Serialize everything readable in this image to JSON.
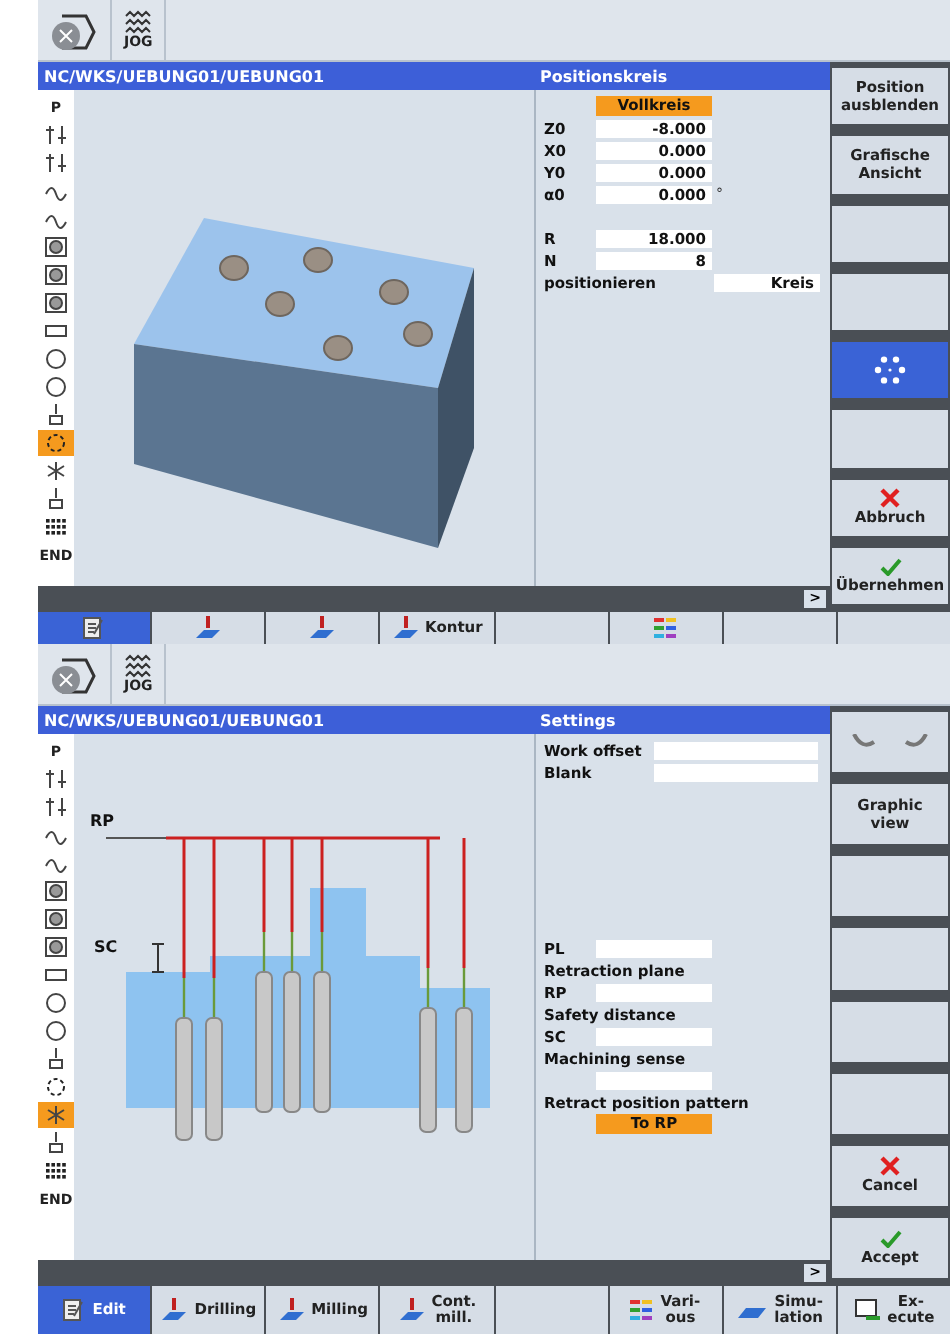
{
  "screens": [
    {
      "mode_label": "JOG",
      "path": "NC/WKS/UEBUNG01/UEBUNG01",
      "panel_title": "Positionskreis",
      "graphic": {
        "kind": "block"
      },
      "more_label": ">",
      "program_steps": [
        {
          "kind": "letter",
          "text": "P",
          "selected": false
        },
        {
          "kind": "arrows",
          "selected": false
        },
        {
          "kind": "arrows",
          "selected": false
        },
        {
          "kind": "wave",
          "selected": false
        },
        {
          "kind": "wave",
          "selected": false
        },
        {
          "kind": "disc",
          "selected": false
        },
        {
          "kind": "disc",
          "selected": false
        },
        {
          "kind": "disc",
          "selected": false
        },
        {
          "kind": "rect",
          "selected": false
        },
        {
          "kind": "circle",
          "selected": false
        },
        {
          "kind": "circle",
          "selected": false
        },
        {
          "kind": "drill",
          "selected": false
        },
        {
          "kind": "ring",
          "selected": true
        },
        {
          "kind": "star",
          "selected": false
        },
        {
          "kind": "drill",
          "selected": false
        },
        {
          "kind": "grid",
          "selected": false
        },
        {
          "kind": "letter",
          "text": "END",
          "selected": false
        }
      ],
      "params": [
        {
          "kind": "select",
          "value": "Vollkreis"
        },
        {
          "kind": "field",
          "label": "Z0",
          "value": "-8.000"
        },
        {
          "kind": "field",
          "label": "X0",
          "value": "0.000"
        },
        {
          "kind": "field",
          "label": "Y0",
          "value": "0.000"
        },
        {
          "kind": "field",
          "label": "α0",
          "value": "0.000",
          "unit": "°"
        },
        {
          "kind": "gap"
        },
        {
          "kind": "field",
          "label": "R",
          "value": "18.000"
        },
        {
          "kind": "field",
          "label": "N",
          "value": "8"
        },
        {
          "kind": "choice",
          "label": "positionieren",
          "value": "Kreis"
        }
      ],
      "softkeys_right": [
        {
          "lines": [
            "Position",
            "ausblenden"
          ],
          "kind": "plain",
          "selected": false
        },
        {
          "lines": [
            "Grafische",
            "Ansicht"
          ],
          "kind": "plain",
          "selected": false
        },
        {
          "kind": "plain",
          "selected": false
        },
        {
          "kind": "plain",
          "selected": false
        },
        {
          "kind": "ring",
          "selected": true
        },
        {
          "kind": "plain",
          "selected": false
        },
        {
          "lines": [
            "Abbruch"
          ],
          "kind": "cross",
          "selected": false
        },
        {
          "lines": [
            "Übernehmen"
          ],
          "kind": "check",
          "selected": false
        }
      ],
      "softkeys_bottom": [
        {
          "kind": "edit",
          "selected": true
        },
        {
          "kind": "drill",
          "selected": false
        },
        {
          "kind": "drill",
          "selected": false
        },
        {
          "lines": [
            "Kontur"
          ],
          "kind": "drill",
          "selected": false
        },
        {
          "kind": "plain",
          "selected": false
        },
        {
          "kind": "bars",
          "selected": false
        },
        {
          "kind": "plain",
          "selected": false
        },
        {
          "kind": "plain",
          "selected": false
        }
      ]
    },
    {
      "mode_label": "JOG",
      "path": "NC/WKS/UEBUNG01/UEBUNG01",
      "panel_title": "Settings",
      "graphic": {
        "kind": "drilling",
        "rp_label": "RP",
        "sc_label": "SC"
      },
      "more_label": ">",
      "program_steps": [
        {
          "kind": "letter",
          "text": "P",
          "selected": false
        },
        {
          "kind": "arrows",
          "selected": false
        },
        {
          "kind": "arrows",
          "selected": false
        },
        {
          "kind": "wave",
          "selected": false
        },
        {
          "kind": "wave",
          "selected": false
        },
        {
          "kind": "disc",
          "selected": false
        },
        {
          "kind": "disc",
          "selected": false
        },
        {
          "kind": "disc",
          "selected": false
        },
        {
          "kind": "rect",
          "selected": false
        },
        {
          "kind": "circle",
          "selected": false
        },
        {
          "kind": "circle",
          "selected": false
        },
        {
          "kind": "drill",
          "selected": false
        },
        {
          "kind": "ring",
          "selected": false
        },
        {
          "kind": "star",
          "selected": true
        },
        {
          "kind": "drill",
          "selected": false
        },
        {
          "kind": "grid",
          "selected": false
        },
        {
          "kind": "letter",
          "text": "END",
          "selected": false
        }
      ],
      "params": [
        {
          "kind": "wide",
          "label": "Work offset"
        },
        {
          "kind": "wide",
          "label": "Blank"
        },
        {
          "kind": "gap"
        },
        {
          "kind": "gap"
        },
        {
          "kind": "gap"
        },
        {
          "kind": "gap"
        },
        {
          "kind": "gap"
        },
        {
          "kind": "gap"
        },
        {
          "kind": "gap"
        },
        {
          "kind": "field",
          "label": "PL"
        },
        {
          "kind": "label",
          "label": "Retraction plane"
        },
        {
          "kind": "field",
          "label": "RP"
        },
        {
          "kind": "label",
          "label": "Safety distance"
        },
        {
          "kind": "field",
          "label": "SC"
        },
        {
          "kind": "label",
          "label": "Machining sense"
        },
        {
          "kind": "field"
        },
        {
          "kind": "label",
          "label": "Retract position pattern"
        },
        {
          "kind": "select",
          "value": "To RP"
        }
      ],
      "softkeys_right": [
        {
          "kind": "partial",
          "selected": false
        },
        {
          "lines": [
            "Graphic",
            "view"
          ],
          "kind": "plain",
          "selected": false
        },
        {
          "kind": "plain",
          "selected": false
        },
        {
          "kind": "plain",
          "selected": false
        },
        {
          "kind": "plain",
          "selected": false
        },
        {
          "kind": "plain",
          "selected": false
        },
        {
          "lines": [
            "Cancel"
          ],
          "kind": "cross",
          "selected": false
        },
        {
          "lines": [
            "Accept"
          ],
          "kind": "check",
          "selected": false
        }
      ],
      "softkeys_bottom": [
        {
          "lines": [
            "Edit"
          ],
          "kind": "edit",
          "selected": true
        },
        {
          "lines": [
            "Drilling"
          ],
          "kind": "drill",
          "selected": false
        },
        {
          "lines": [
            "Milling"
          ],
          "kind": "drill",
          "selected": false
        },
        {
          "lines": [
            "Cont.",
            "mill."
          ],
          "kind": "drill",
          "selected": false
        },
        {
          "kind": "plain",
          "selected": false
        },
        {
          "lines": [
            "Vari-",
            "ous"
          ],
          "kind": "bars",
          "selected": false
        },
        {
          "lines": [
            "Simu-",
            "lation"
          ],
          "kind": "sim",
          "selected": false
        },
        {
          "lines": [
            "Ex-",
            "ecute"
          ],
          "kind": "nc",
          "selected": false
        }
      ]
    }
  ]
}
